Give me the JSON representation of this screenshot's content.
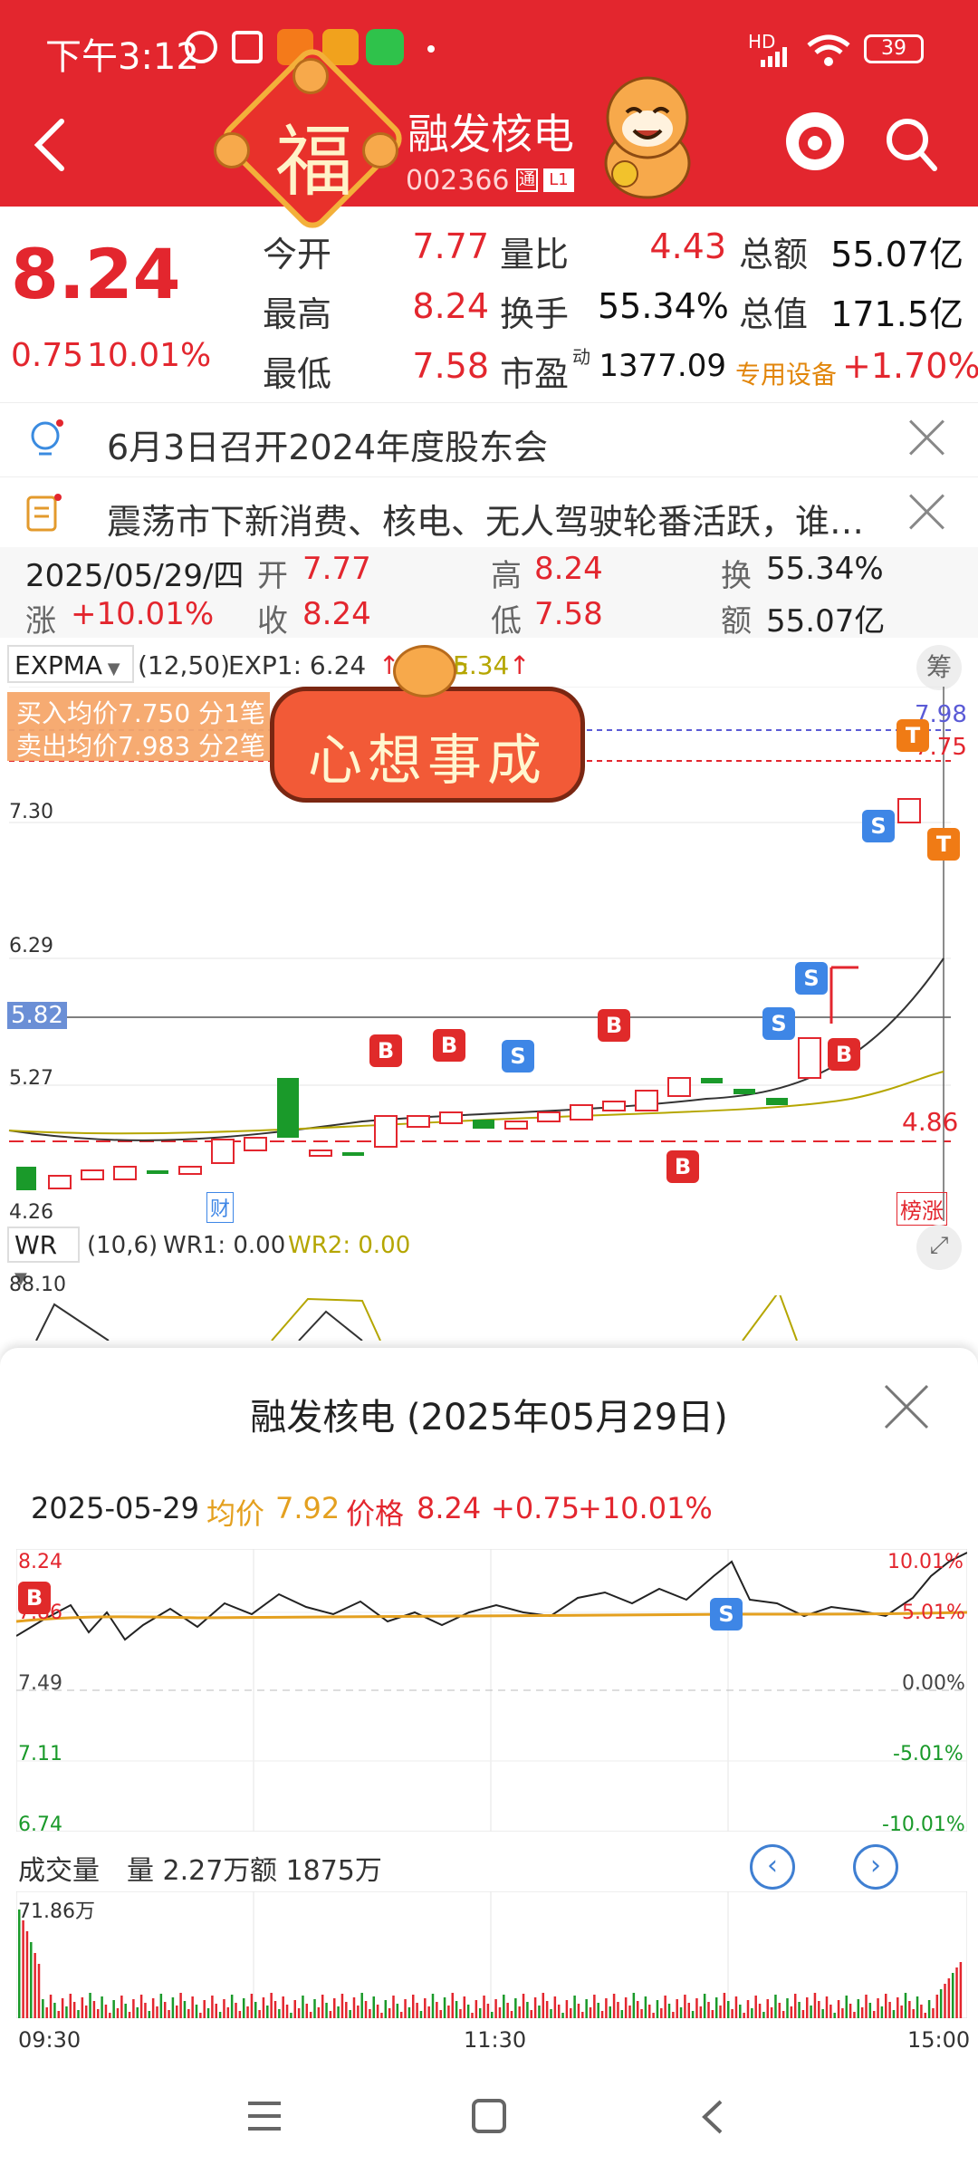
{
  "status_bar": {
    "time": "下午3:12",
    "battery": "39",
    "network": "HD"
  },
  "header": {
    "stock_name": "融发核电",
    "stock_code": "002366",
    "badge_tong": "通",
    "badge_level": "L1",
    "fu_char": "福"
  },
  "quote": {
    "price": "8.24",
    "change": "0.75",
    "change_pct": "10.01%",
    "open_label": "今开",
    "open": "7.77",
    "high_label": "最高",
    "high": "8.24",
    "low_label": "最低",
    "low": "7.58",
    "volratio_label": "量比",
    "volratio": "4.43",
    "turnover_label": "换手",
    "turnover": "55.34%",
    "pe_label": "市盈",
    "pe_sup": "动",
    "pe": "1377.09",
    "amount_label": "总额",
    "amount": "55.07亿",
    "mktcap_label": "总值",
    "mktcap": "171.5亿",
    "sector": "专用设备",
    "sector_change": "+1.70%"
  },
  "news": [
    {
      "text": "6月3日召开2024年度股东会"
    },
    {
      "text": "震荡市下新消费、核电、无人驾驶轮番活跃，谁…"
    }
  ],
  "day_info": {
    "date": "2025/05/29/四",
    "open_label": "开",
    "open": "7.77",
    "high_label": "高",
    "high": "8.24",
    "turn_label": "换",
    "turn": "55.34%",
    "chg_label": "涨",
    "chg": "+10.01%",
    "close_label": "收",
    "close": "8.24",
    "low_label": "低",
    "low": "7.58",
    "amt_label": "额",
    "amt": "55.07亿"
  },
  "kline": {
    "indicator": "EXPMA",
    "params": "(12,50)",
    "exp1": "EXP1: 6.24",
    "exp2_partial": "5.34",
    "exp2_prefix": "E",
    "chou": "筹",
    "buy_avg": "买入均价7.750 分1笔",
    "sell_avg": "卖出均价7.983 分2笔",
    "axis": [
      "7.30",
      "6.29",
      "5.82",
      "5.27",
      "4.26"
    ],
    "right_labels": [
      "7.98",
      "7.75",
      "4.86"
    ],
    "cai": "财",
    "bangzhang": "榜涨",
    "banner": "心想事成"
  },
  "wr": {
    "name": "WR",
    "params": "(10,6)",
    "wr1": "WR1: 0.00",
    "wr2": "WR2: 0.00",
    "top": "88.10"
  },
  "sheet": {
    "title": "融发核电 (2025年05月29日)",
    "date": "2025-05-29",
    "avg_label": "均价",
    "avg": "7.92",
    "price_label": "价格",
    "price": "8.24",
    "chg": "+0.75",
    "pct": "+10.01%",
    "left_axis": [
      "8.24",
      "7.86",
      "7.49",
      "7.11",
      "6.74"
    ],
    "right_axis": [
      "10.01%",
      "5.01%",
      "0.00%",
      "-5.01%",
      "-10.01%"
    ],
    "vol_label": "成交量",
    "vol": "量 2.27万",
    "amt": "额 1875万",
    "vol_max": "71.86万",
    "time_start": "09:30",
    "time_mid": "11:30",
    "time_end": "15:00"
  },
  "colors": {
    "brand_red": "#e3262e",
    "up": "#e3262e",
    "down": "#1a9a2a",
    "avg_line": "#e4a01f"
  }
}
